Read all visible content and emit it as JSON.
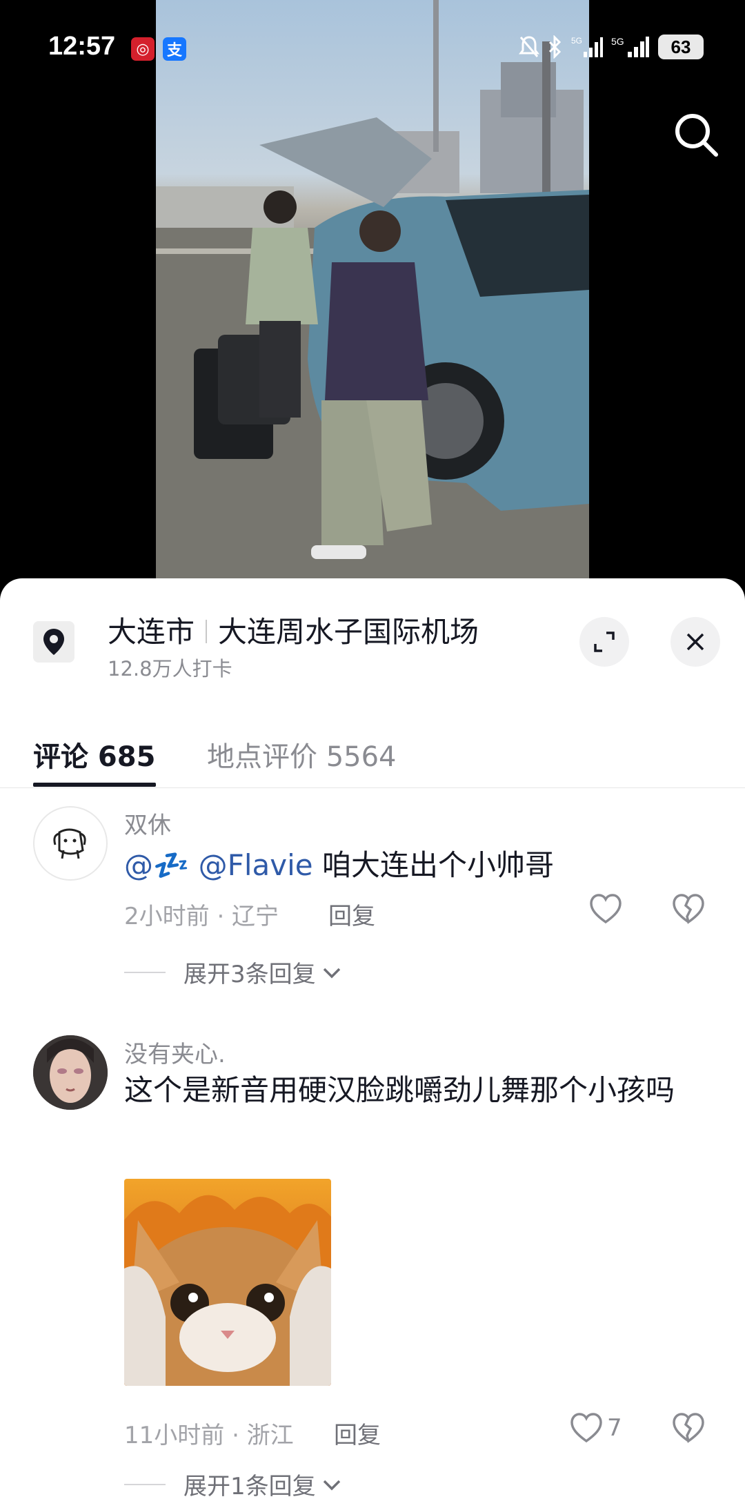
{
  "status_bar": {
    "time": "12:57",
    "battery": "63",
    "network": "5G"
  },
  "location": {
    "city": "大连市",
    "place": "大连周水子国际机场",
    "checkins": "12.8万人打卡"
  },
  "tabs": [
    {
      "label": "评论 685"
    },
    {
      "label": "地点评价 5564"
    }
  ],
  "comments": [
    {
      "user": "双休",
      "mention1": "@💤",
      "mention2": "@Flavie",
      "text": "咱大连出个小帅哥",
      "meta": "2小时前 · 辽宁",
      "reply_label": "回复",
      "likes": "",
      "expand_label": "展开3条回复"
    },
    {
      "user": "没有夹心.",
      "text": "这个是新音用硬汉脸跳嚼劲儿舞那个小孩吗",
      "meta": "11小时前 · 浙江",
      "reply_label": "回复",
      "likes": "7",
      "expand_label": "展开1条回复"
    }
  ],
  "colors": {
    "accent_mention": "#2f5aa8",
    "text_primary": "#161823",
    "text_secondary": "#8a8b91"
  }
}
